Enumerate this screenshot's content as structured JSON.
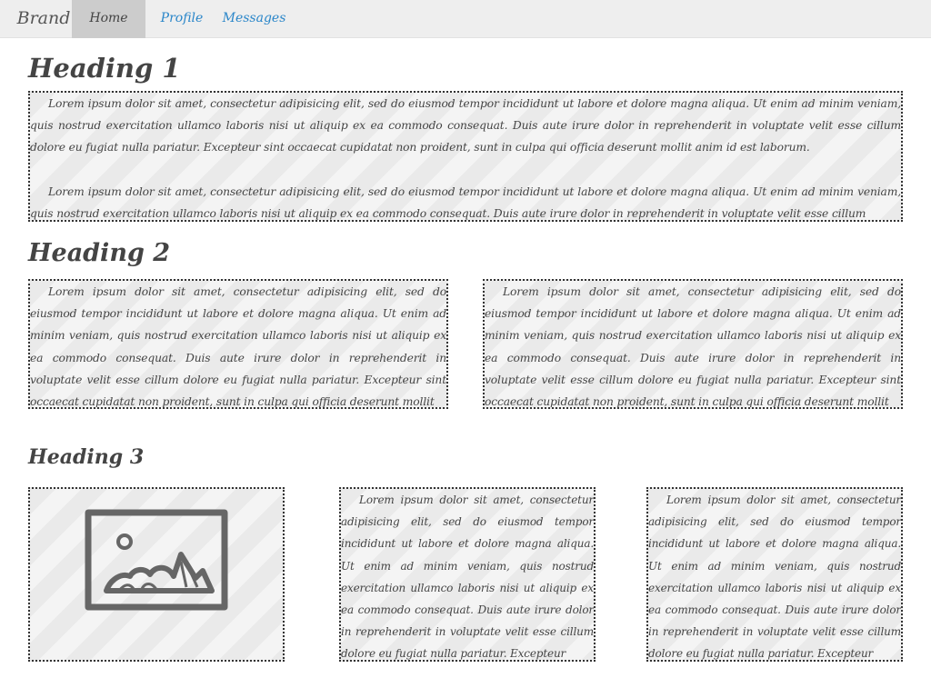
{
  "navbar": {
    "brand": "Brand",
    "items": [
      {
        "label": "Home",
        "active": true
      },
      {
        "label": "Profile",
        "active": false
      },
      {
        "label": "Messages",
        "active": false
      }
    ]
  },
  "section1": {
    "heading": "Heading 1",
    "paragraphs": [
      "Lorem ipsum dolor sit amet, consectetur adipisicing elit, sed do eiusmod tempor incididunt ut labore et dolore magna aliqua. Ut enim ad minim veniam, quis nostrud exercitation ullamco laboris nisi ut aliquip ex ea commodo consequat. Duis aute irure dolor in reprehenderit in voluptate velit esse cillum dolore eu fugiat nulla pariatur. Excepteur sint occaecat cupidatat non proident, sunt in culpa qui officia deserunt mollit anim id est laborum.",
      "Lorem ipsum dolor sit amet, consectetur adipisicing elit, sed do eiusmod tempor incididunt ut labore et dolore magna aliqua. Ut enim ad minim veniam, quis nostrud exercitation ullamco laboris nisi ut aliquip ex ea commodo consequat. Duis aute irure dolor in reprehenderit in voluptate velit esse cillum"
    ]
  },
  "section2": {
    "heading": "Heading 2",
    "columns": [
      "Lorem ipsum dolor sit amet, consectetur adipisicing elit, sed do eiusmod tempor incididunt ut labore et dolore magna aliqua. Ut enim ad minim veniam, quis nostrud exercitation ullamco laboris nisi ut aliquip ex ea commodo consequat. Duis aute irure dolor in reprehenderit in voluptate velit esse cillum dolore eu fugiat nulla pariatur. Excepteur sint occaecat cupidatat non proident, sunt in culpa qui officia deserunt mollit",
      "Lorem ipsum dolor sit amet, consectetur adipisicing elit, sed do eiusmod tempor incididunt ut labore et dolore magna aliqua. Ut enim ad minim veniam, quis nostrud exercitation ullamco laboris nisi ut aliquip ex ea commodo consequat. Duis aute irure dolor in reprehenderit in voluptate velit esse cillum dolore eu fugiat nulla pariatur. Excepteur sint occaecat cupidatat non proident, sunt in culpa qui officia deserunt mollit"
    ]
  },
  "section3": {
    "heading": "Heading 3",
    "image_icon": "image-placeholder-icon",
    "columns": [
      "Lorem ipsum dolor sit amet, consectetur adipisicing elit, sed do eiusmod tempor incididunt ut labore et dolore magna aliqua. Ut enim ad minim veniam, quis nostrud exercitation ullamco laboris nisi ut aliquip ex ea commodo consequat. Duis aute irure dolor in reprehenderit in voluptate velit esse cillum dolore eu fugiat nulla pariatur. Excepteur",
      "Lorem ipsum dolor sit amet, consectetur adipisicing elit, sed do eiusmod tempor incididunt ut labore et dolore magna aliqua. Ut enim ad minim veniam, quis nostrud exercitation ullamco laboris nisi ut aliquip ex ea commodo consequat. Duis aute irure dolor in reprehenderit in voluptate velit esse cillum dolore eu fugiat nulla pariatur. Excepteur"
    ]
  },
  "colors": {
    "navbar_bg": "#eeeeee",
    "active_tab_bg": "#cccccc",
    "link": "#2a86c9",
    "text": "#444444"
  }
}
